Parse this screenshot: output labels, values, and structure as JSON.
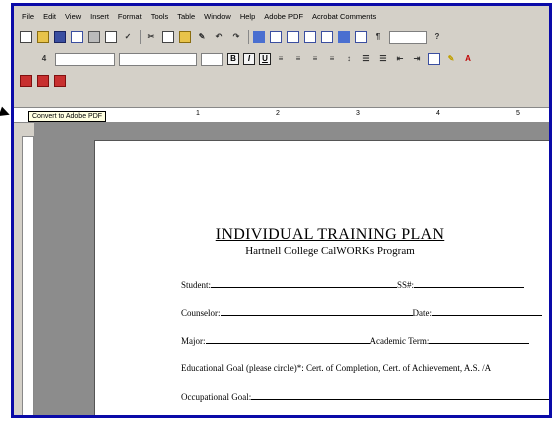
{
  "menu": [
    "File",
    "Edit",
    "View",
    "Insert",
    "Format",
    "Tools",
    "Table",
    "Window",
    "Help",
    "Adobe PDF",
    "Acrobat Comments"
  ],
  "toolbar": {
    "zoom_value": "",
    "font_name": "",
    "font_size": "",
    "bold": "B",
    "italic": "I",
    "underline": "U",
    "style_value": "4"
  },
  "tooltip": "Convert to Adobe PDF",
  "ruler": [
    "1",
    "2",
    "3",
    "4",
    "5"
  ],
  "document": {
    "title": "INDIVIDUAL TRAINING PLAN",
    "subtitle": "Hartnell College CalWORKs Program",
    "student_label": "Student:",
    "ss_label": "SS#:",
    "counselor_label": "Counselor:",
    "date_label": "Date:",
    "major_label": "Major:",
    "term_label": "Academic Term:",
    "goal_text": "Educational Goal (please circle)*: Cert. of Completion, Cert. of Achievement, A.S. /A",
    "occupational_label": "Occupational Goal:"
  }
}
